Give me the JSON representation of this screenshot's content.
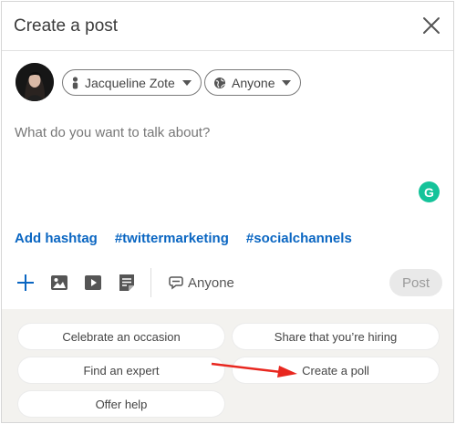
{
  "dialog": {
    "title": "Create a post",
    "close_icon": "close-icon"
  },
  "author": {
    "name": "Jacqueline Zote",
    "audience": "Anyone"
  },
  "editor": {
    "placeholder": "What do you want to talk about?",
    "grammarly_letter": "G"
  },
  "hashtags": {
    "add_label": "Add hashtag",
    "tags": [
      "#twittermarketing",
      "#socialchannels"
    ]
  },
  "toolbar": {
    "comment_visibility": "Anyone",
    "post_label": "Post"
  },
  "suggestions": {
    "items": [
      "Celebrate an occasion",
      "Share that you’re hiring",
      "Find an expert",
      "Create a poll",
      "Offer help"
    ]
  },
  "colors": {
    "link": "#0a66c2",
    "grammarly": "#15c39a",
    "arrow": "#e8271f"
  }
}
